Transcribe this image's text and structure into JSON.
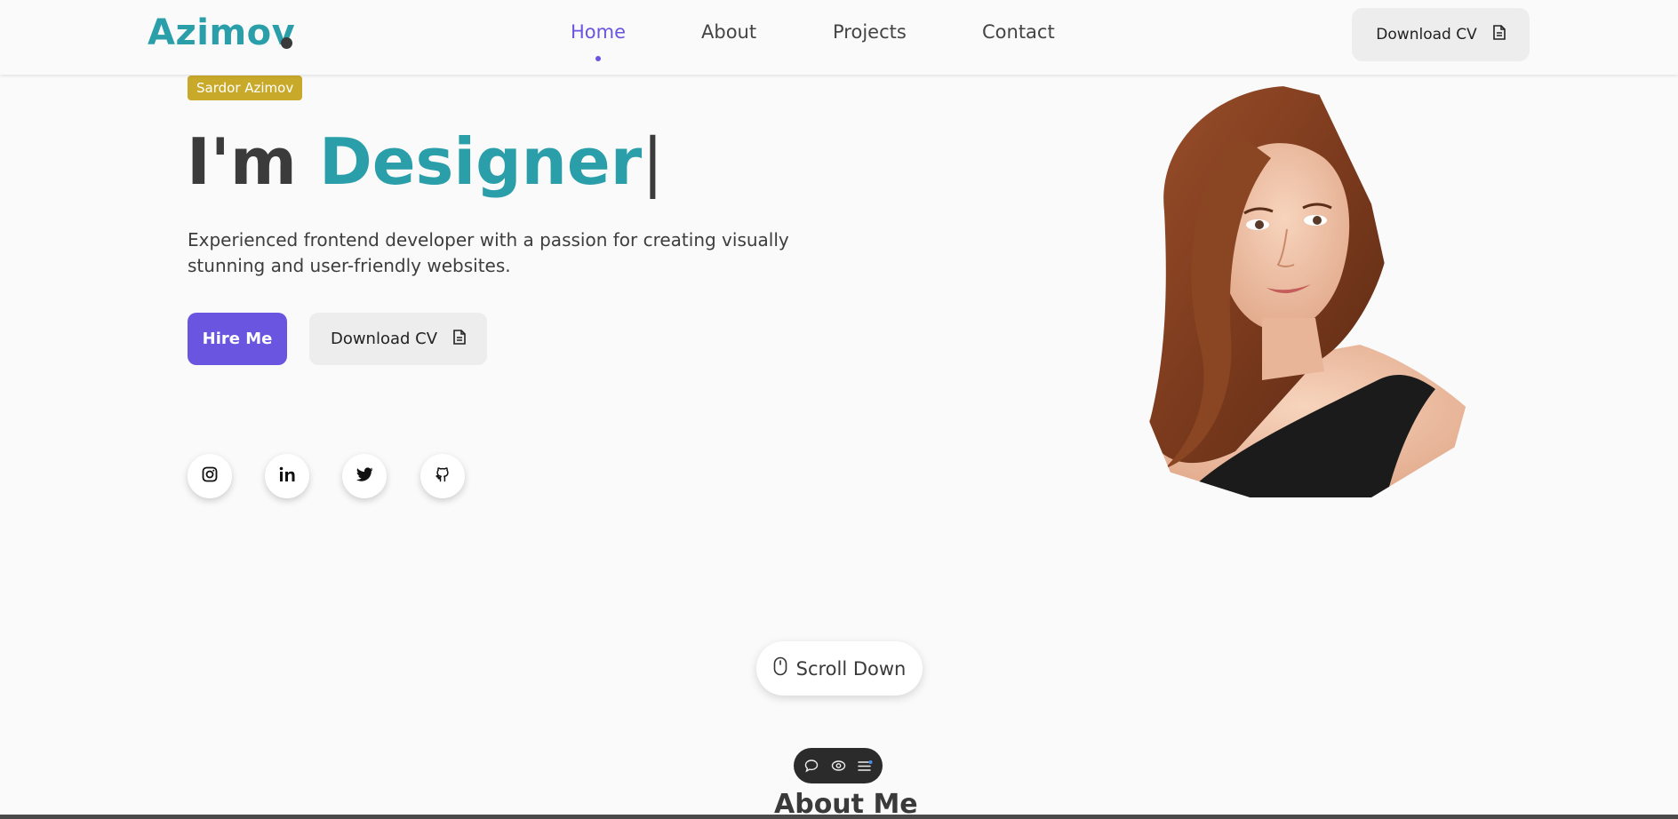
{
  "header": {
    "logo": "Azimov",
    "nav": [
      {
        "label": "Home",
        "active": true
      },
      {
        "label": "About",
        "active": false
      },
      {
        "label": "Projects",
        "active": false
      },
      {
        "label": "Contact",
        "active": false
      }
    ],
    "cv_button": {
      "label": "Download CV",
      "icon": "document-icon"
    }
  },
  "hero": {
    "badge": "Sardor Azimov",
    "headline_prefix": "I'm",
    "headline_role": "Designer",
    "headline_caret": "|",
    "description": "Experienced frontend developer with a passion for creating visually stunning and user-friendly websites.",
    "hire_button": "Hire Me",
    "cv_button": {
      "label": "Download CV",
      "icon": "document-icon"
    },
    "socials": [
      "instagram-icon",
      "linkedin-icon",
      "twitter-icon",
      "github-icon"
    ]
  },
  "scroll_down": {
    "label": "Scroll Down",
    "icon": "mouse-icon"
  },
  "toolbar": {
    "icons": [
      "comment-icon",
      "eye-icon",
      "list-icon"
    ]
  },
  "about": {
    "title": "About Me"
  },
  "colors": {
    "accent": "#2a9faa",
    "primary": "#6a55e0",
    "badge": "#c9a92a",
    "background": "#fafafa"
  }
}
